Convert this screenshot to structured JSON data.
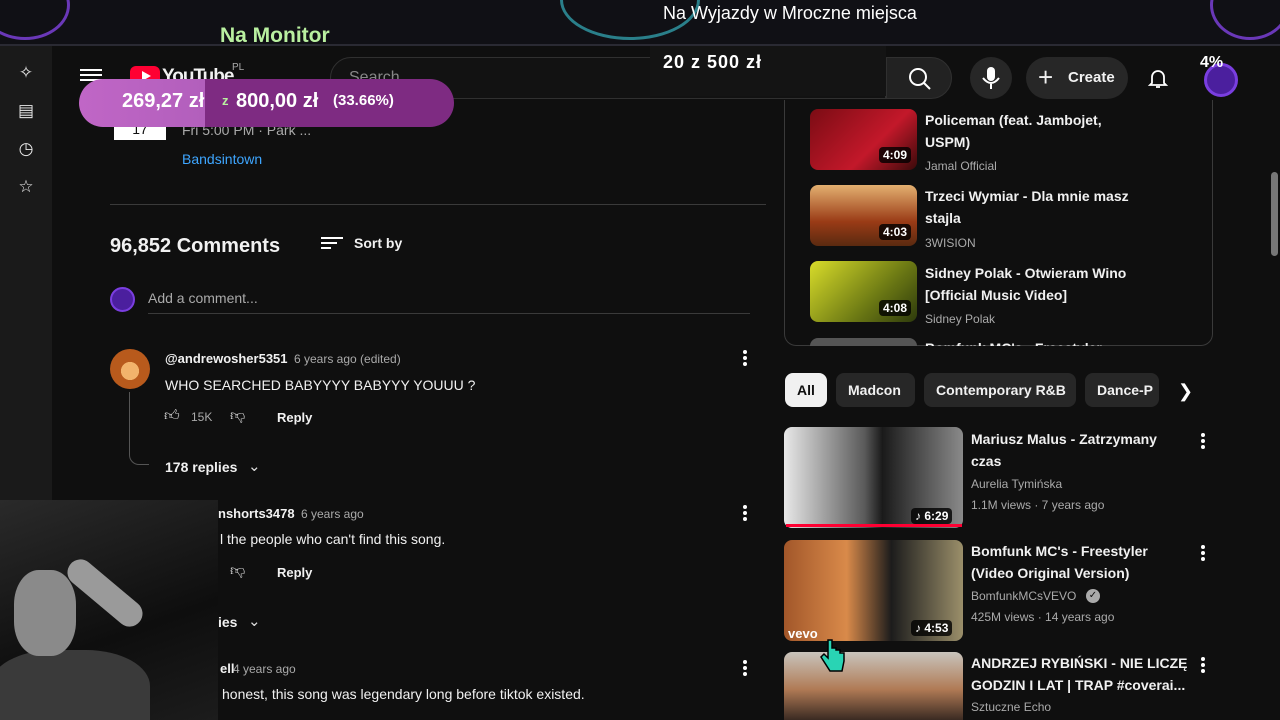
{
  "overlay": {
    "na_monitor": "Na Monitor",
    "goal_title": "Na Wyjazdy w Mroczne miejsca",
    "goal_count": "20 z 500 zł",
    "percent": "4%"
  },
  "donation": {
    "current": "269,27 zł",
    "separator": "z",
    "goal": "800,00 zł",
    "percent": "(33.66%)",
    "progress_fraction": 0.3366
  },
  "rail": {
    "icons": [
      "sparkle-icon",
      "subscriptions-icon",
      "history-icon",
      "star-icon"
    ]
  },
  "header": {
    "logo_text": "YouTube",
    "region": "PL",
    "search_placeholder": "Search",
    "create_label": "Create"
  },
  "event": {
    "date": "17",
    "time": "Fri 5:00 PM · Park ...",
    "source": "Bandsintown"
  },
  "comments": {
    "title": "96,852 Comments",
    "sort_label": "Sort by",
    "add_placeholder": "Add a comment...",
    "items": [
      {
        "author": "@andrewosher5351",
        "time": "6 years ago (edited)",
        "text": "WHO SEARCHED BABYYYY BABYYY YOUUU ?",
        "likes": "15K",
        "reply": "Reply",
        "replies": "178 replies"
      },
      {
        "author": "nshorts3478",
        "time": "6 years ago",
        "text": "l the people who can't find this song.",
        "reply": "Reply",
        "replies": "ies"
      },
      {
        "author": "ell",
        "time": "4 years ago",
        "text": "honest, this song was legendary long before tiktok existed."
      }
    ]
  },
  "playlist": [
    {
      "title1": "Policeman (feat. Jambojet,",
      "title2": "USPM)",
      "channel": "Jamal Official",
      "duration": "4:09",
      "color": "#c3182a"
    },
    {
      "title1": "Trzeci Wymiar - Dla mnie masz",
      "title2": "stajla",
      "channel": "3WISION",
      "duration": "4:03",
      "color": "#c0671e"
    },
    {
      "title1": "Sidney Polak - Otwieram Wino",
      "title2": "[Official Music Video]",
      "channel": "Sidney Polak",
      "duration": "4:08",
      "color": "#b9c21a"
    },
    {
      "title1": "Bomfunk MC's - Freestyler",
      "title2": "",
      "channel": "",
      "duration": "",
      "color": "#555555"
    }
  ],
  "chips": [
    "All",
    "Madcon",
    "Contemporary R&B",
    "Dance-P"
  ],
  "recommended": [
    {
      "title1": "Mariusz Malus - Zatrzymany",
      "title2": "czas",
      "channel": "Aurelia Tymińska",
      "meta": "1.1M views · 7 years ago",
      "duration": "6:29",
      "progress": 1.0
    },
    {
      "title1": "Bomfunk MC's - Freestyler",
      "title2": "(Video Original Version)",
      "channel": "BomfunkMCsVEVO",
      "meta": "425M views · 14 years ago",
      "duration": "4:53",
      "badge": "vevo"
    },
    {
      "title1": "ANDRZEJ RYBIŃSKI - NIE LICZĘ",
      "title2": "GODZIN I LAT | TRAP #coverai...",
      "channel": "Sztuczne Echo"
    }
  ]
}
